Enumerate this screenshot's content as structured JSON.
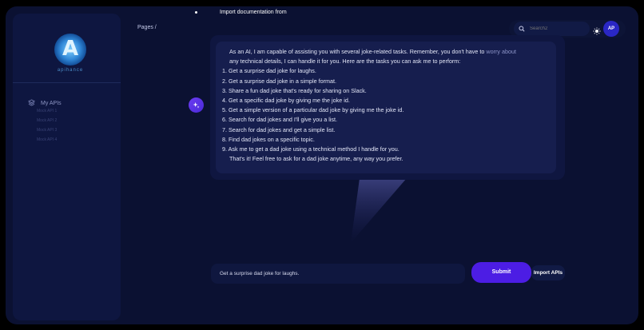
{
  "brand": {
    "logo_letter": "A",
    "name": "apihance"
  },
  "sidebar": {
    "header_label": "My APIs",
    "items": [
      {
        "label": "Mock API 1"
      },
      {
        "label": "Mock API 2"
      },
      {
        "label": "Mock API 3"
      },
      {
        "label": "Mock API 4"
      }
    ]
  },
  "header": {
    "breadcrumb": "Pages  /",
    "title": "Import documentation from",
    "search_placeholder": "Search2",
    "avatar_initials": "AP"
  },
  "chat": {
    "intro": "As an AI, I am capable of assisting you with several joke-related tasks. Remember, you don't have to worry about any technical details, I can handle it for you. Here are the tasks you can ask me to perform:",
    "intro_line1": "As an AI, I am capable of assisting you with several joke-related tasks. Remember, you don't have to ",
    "intro_faded": "worry about",
    "intro_line2": "any technical details, I can handle it for you. Here are the tasks you can ask me to perform:",
    "tasks": [
      "1. Get a surprise dad joke for laughs.",
      "2. Get a surprise dad joke in a simple format.",
      "3. Share a fun dad joke that's ready for sharing on Slack.",
      "4. Get a specific dad joke by giving me the joke id.",
      "5. Get a simple version of a particular dad joke by giving me the joke id.",
      "6. Search for dad jokes and I'll give you a list.",
      "7. Search for dad jokes and get a simple list.",
      "8. Find dad jokes on a specific topic.",
      "9. Ask me to get a dad joke using a technical method I handle for you."
    ],
    "closing": "That's it! Feel free to ask for a dad joke anytime, any way you prefer."
  },
  "composer": {
    "value": "Get a surprise dad joke for laughs.",
    "submit_label": "Submit",
    "import_label": "Import APIs"
  },
  "colors": {
    "background": "#0b1132",
    "accent": "#4c1de4",
    "avatar": "#2a27c4"
  }
}
